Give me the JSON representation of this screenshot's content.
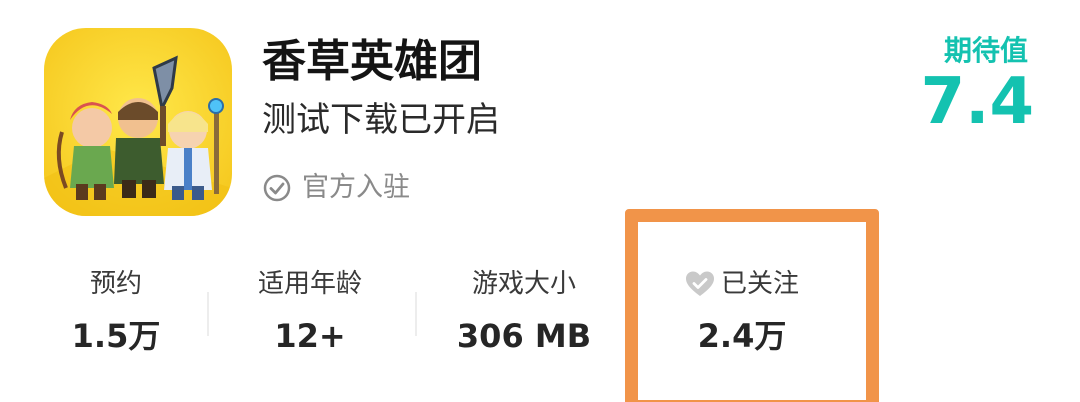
{
  "app": {
    "title": "香草英雄团",
    "subtitle": "测试下载已开启",
    "official_label": "官方入驻",
    "icon": "game-app-icon"
  },
  "expectation": {
    "label": "期待值",
    "score": "7.4",
    "color": "#14c2b0"
  },
  "stats": [
    {
      "label": "预约",
      "value": "1.5万"
    },
    {
      "label": "适用年龄",
      "value": "12+"
    },
    {
      "label": "游戏大小",
      "value": "306 MB"
    },
    {
      "label": "已关注",
      "value": "2.4万",
      "icon": "heart-icon"
    }
  ],
  "colors": {
    "highlight": "#f19449",
    "text_primary": "#141414",
    "text_muted": "#8a8a8a"
  }
}
